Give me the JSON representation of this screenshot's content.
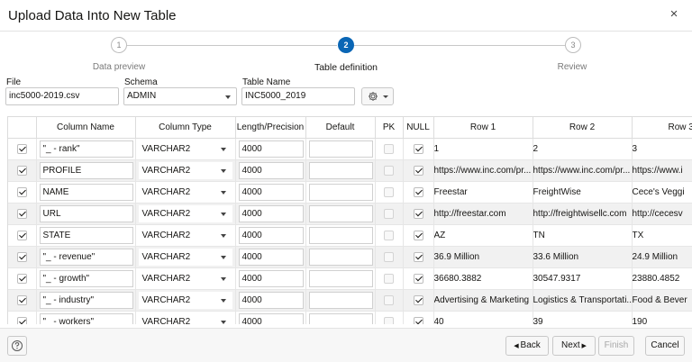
{
  "dialog": {
    "title": "Upload Data Into New Table",
    "close_icon": "×"
  },
  "wizard": {
    "steps": [
      {
        "number": "1",
        "label": "Data preview",
        "state": "done"
      },
      {
        "number": "2",
        "label": "Table definition",
        "state": "active"
      },
      {
        "number": "3",
        "label": "Review",
        "state": "pending"
      }
    ]
  },
  "form": {
    "file": {
      "label": "File",
      "value": "inc5000-2019.csv"
    },
    "schema": {
      "label": "Schema",
      "value": "ADMIN"
    },
    "table_name": {
      "label": "Table Name",
      "value": "INC5000_2019"
    },
    "settings_icon": "gear-icon"
  },
  "grid": {
    "headers": [
      "Column Name",
      "Column Type",
      "Length/Precision",
      "Default",
      "PK",
      "NULL",
      "Row 1",
      "Row 2",
      "Row 3"
    ],
    "rows": [
      {
        "include": true,
        "name": "\"_ - rank\"",
        "type": "VARCHAR2",
        "length": "4000",
        "default": "",
        "pk": false,
        "null": true,
        "r1": "1",
        "r2": "2",
        "r3": "3"
      },
      {
        "include": true,
        "name": "PROFILE",
        "type": "VARCHAR2",
        "length": "4000",
        "default": "",
        "pk": false,
        "null": true,
        "r1": "https://www.inc.com/pr...",
        "r2": "https://www.inc.com/pr...",
        "r3": "https://www.i"
      },
      {
        "include": true,
        "name": "NAME",
        "type": "VARCHAR2",
        "length": "4000",
        "default": "",
        "pk": false,
        "null": true,
        "r1": "Freestar",
        "r2": "FreightWise",
        "r3": "Cece's Veggi"
      },
      {
        "include": true,
        "name": "URL",
        "type": "VARCHAR2",
        "length": "4000",
        "default": "",
        "pk": false,
        "null": true,
        "r1": "http://freestar.com",
        "r2": "http://freightwisellc.com",
        "r3": "http://cecesv"
      },
      {
        "include": true,
        "name": "STATE",
        "type": "VARCHAR2",
        "length": "4000",
        "default": "",
        "pk": false,
        "null": true,
        "r1": "AZ",
        "r2": "TN",
        "r3": "TX"
      },
      {
        "include": true,
        "name": "\"_ - revenue\"",
        "type": "VARCHAR2",
        "length": "4000",
        "default": "",
        "pk": false,
        "null": true,
        "r1": "36.9 Million",
        "r2": "33.6 Million",
        "r3": "24.9 Million"
      },
      {
        "include": true,
        "name": "\"_ - growth\"",
        "type": "VARCHAR2",
        "length": "4000",
        "default": "",
        "pk": false,
        "null": true,
        "r1": "36680.3882",
        "r2": "30547.9317",
        "r3": "23880.4852"
      },
      {
        "include": true,
        "name": "\"_ - industry\"",
        "type": "VARCHAR2",
        "length": "4000",
        "default": "",
        "pk": false,
        "null": true,
        "r1": "Advertising & Marketing",
        "r2": "Logistics & Transportati...",
        "r3": "Food & Bever"
      },
      {
        "include": true,
        "name": "\"_ - workers\"",
        "type": "VARCHAR2",
        "length": "4000",
        "default": "",
        "pk": false,
        "null": true,
        "r1": "40",
        "r2": "39",
        "r3": "190"
      }
    ]
  },
  "footer": {
    "help_icon": "help-icon",
    "back_label": "Back",
    "next_label": "Next",
    "finish_label": "Finish",
    "cancel_label": "Cancel"
  },
  "colors": {
    "accent": "#0a66b5",
    "row_alt": "#f1f1f1",
    "disabled_text": "#a8a8a8"
  }
}
